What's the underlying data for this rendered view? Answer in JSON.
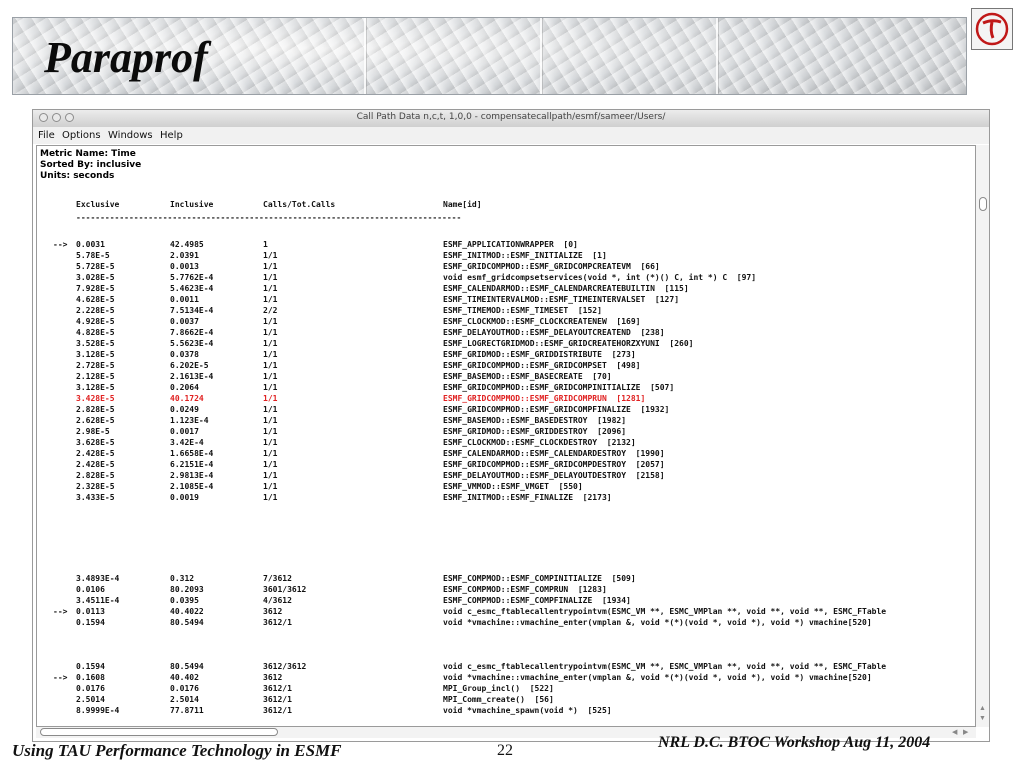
{
  "slide": {
    "title": "Paraprof",
    "footer_left": "Using TAU Performance Technology in ESMF",
    "page_number": "22",
    "footer_right": "NRL D.C. BTOC Workshop Aug 11, 2004",
    "logo_icon": "tau-logo-icon"
  },
  "window": {
    "title": "Call Path Data n,c,t, 1,0,0 - compensatecallpath/esmf/sameer/Users/",
    "menu": [
      "File",
      "Options",
      "Windows",
      "Help"
    ],
    "metric_name": "Metric Name: Time",
    "sorted_by": "Sorted By: inclusive",
    "units": "Units: seconds"
  },
  "table": {
    "headers": {
      "exclusive": "Exclusive",
      "inclusive": "Inclusive",
      "calls": "Calls/Tot.Calls",
      "name": "Name[id]"
    },
    "separator": "--------------------------------------------------------------------------------",
    "blocks": [
      [
        {
          "arrow": "-->",
          "exc": "0.0031",
          "inc": "42.4985",
          "calls": "1",
          "name": "ESMF_APPLICATIONWRAPPER  [0]"
        },
        {
          "arrow": "",
          "exc": "5.78E-5",
          "inc": "2.0391",
          "calls": "1/1",
          "name": "ESMF_INITMOD::ESMF_INITIALIZE  [1]"
        },
        {
          "arrow": "",
          "exc": "5.728E-5",
          "inc": "0.0013",
          "calls": "1/1",
          "name": "ESMF_GRIDCOMPMOD::ESMF_GRIDCOMPCREATEVM  [66]"
        },
        {
          "arrow": "",
          "exc": "3.028E-5",
          "inc": "5.7762E-4",
          "calls": "1/1",
          "name": "void esmf_gridcompsetservices(void *, int (*)() C, int *) C  [97]"
        },
        {
          "arrow": "",
          "exc": "7.928E-5",
          "inc": "5.4623E-4",
          "calls": "1/1",
          "name": "ESMF_CALENDARMOD::ESMF_CALENDARCREATEBUILTIN  [115]"
        },
        {
          "arrow": "",
          "exc": "4.628E-5",
          "inc": "0.0011",
          "calls": "1/1",
          "name": "ESMF_TIMEINTERVALMOD::ESMF_TIMEINTERVALSET  [127]"
        },
        {
          "arrow": "",
          "exc": "2.228E-5",
          "inc": "7.5134E-4",
          "calls": "2/2",
          "name": "ESMF_TIMEMOD::ESMF_TIMESET  [152]"
        },
        {
          "arrow": "",
          "exc": "4.928E-5",
          "inc": "0.0037",
          "calls": "1/1",
          "name": "ESMF_CLOCKMOD::ESMF_CLOCKCREATENEW  [169]"
        },
        {
          "arrow": "",
          "exc": "4.828E-5",
          "inc": "7.8662E-4",
          "calls": "1/1",
          "name": "ESMF_DELAYOUTMOD::ESMF_DELAYOUTCREATEND  [238]"
        },
        {
          "arrow": "",
          "exc": "3.528E-5",
          "inc": "5.5623E-4",
          "calls": "1/1",
          "name": "ESMF_LOGRECTGRIDMOD::ESMF_GRIDCREATEHORZXYUNI  [260]"
        },
        {
          "arrow": "",
          "exc": "3.128E-5",
          "inc": "0.0378",
          "calls": "1/1",
          "name": "ESMF_GRIDMOD::ESMF_GRIDDISTRIBUTE  [273]"
        },
        {
          "arrow": "",
          "exc": "2.728E-5",
          "inc": "6.202E-5",
          "calls": "1/1",
          "name": "ESMF_GRIDCOMPMOD::ESMF_GRIDCOMPSET  [498]"
        },
        {
          "arrow": "",
          "exc": "2.128E-5",
          "inc": "2.1613E-4",
          "calls": "1/1",
          "name": "ESMF_BASEMOD::ESMF_BASECREATE  [70]"
        },
        {
          "arrow": "",
          "exc": "3.128E-5",
          "inc": "0.2064",
          "calls": "1/1",
          "name": "ESMF_GRIDCOMPMOD::ESMF_GRIDCOMPINITIALIZE  [507]"
        },
        {
          "arrow": "",
          "exc": "3.428E-5",
          "inc": "40.1724",
          "calls": "1/1",
          "name": "ESMF_GRIDCOMPMOD::ESMF_GRIDCOMPRUN  [1281]",
          "highlight": true
        },
        {
          "arrow": "",
          "exc": "2.828E-5",
          "inc": "0.0249",
          "calls": "1/1",
          "name": "ESMF_GRIDCOMPMOD::ESMF_GRIDCOMPFINALIZE  [1932]"
        },
        {
          "arrow": "",
          "exc": "2.628E-5",
          "inc": "1.123E-4",
          "calls": "1/1",
          "name": "ESMF_BASEMOD::ESMF_BASEDESTROY  [1982]"
        },
        {
          "arrow": "",
          "exc": "2.98E-5",
          "inc": "0.0017",
          "calls": "1/1",
          "name": "ESMF_GRIDMOD::ESMF_GRIDDESTROY  [2096]"
        },
        {
          "arrow": "",
          "exc": "3.628E-5",
          "inc": "3.42E-4",
          "calls": "1/1",
          "name": "ESMF_CLOCKMOD::ESMF_CLOCKDESTROY  [2132]"
        },
        {
          "arrow": "",
          "exc": "2.428E-5",
          "inc": "1.6658E-4",
          "calls": "1/1",
          "name": "ESMF_CALENDARMOD::ESMF_CALENDARDESTROY  [1990]"
        },
        {
          "arrow": "",
          "exc": "2.428E-5",
          "inc": "6.2151E-4",
          "calls": "1/1",
          "name": "ESMF_GRIDCOMPMOD::ESMF_GRIDCOMPDESTROY  [2057]"
        },
        {
          "arrow": "",
          "exc": "2.828E-5",
          "inc": "2.9813E-4",
          "calls": "1/1",
          "name": "ESMF_DELAYOUTMOD::ESMF_DELAYOUTDESTROY  [2158]"
        },
        {
          "arrow": "",
          "exc": "2.328E-5",
          "inc": "2.1085E-4",
          "calls": "1/1",
          "name": "ESMF_VMMOD::ESMF_VMGET  [550]"
        },
        {
          "arrow": "",
          "exc": "3.433E-5",
          "inc": "0.0019",
          "calls": "1/1",
          "name": "ESMF_INITMOD::ESMF_FINALIZE  [2173]"
        }
      ],
      [
        {
          "arrow": "",
          "exc": "3.4893E-4",
          "inc": "0.312",
          "calls": "7/3612",
          "name": "ESMF_COMPMOD::ESMF_COMPINITIALIZE  [509]"
        },
        {
          "arrow": "",
          "exc": "0.0106",
          "inc": "80.2093",
          "calls": "3601/3612",
          "name": "ESMF_COMPMOD::ESMF_COMPRUN  [1283]"
        },
        {
          "arrow": "",
          "exc": "3.4511E-4",
          "inc": "0.0395",
          "calls": "4/3612",
          "name": "ESMF_COMPMOD::ESMF_COMPFINALIZE  [1934]"
        },
        {
          "arrow": "-->",
          "exc": "0.0113",
          "inc": "40.4022",
          "calls": "3612",
          "name": "void c_esmc_ftablecallentrypointvm(ESMC_VM **, ESMC_VMPlan **, void **, void **, ESMC_FTable"
        },
        {
          "arrow": "",
          "exc": "0.1594",
          "inc": "80.5494",
          "calls": "3612/1",
          "name": "void *vmachine::vmachine_enter(vmplan &, void *(*)(void *, void *), void *) vmachine[520]"
        }
      ],
      [
        {
          "arrow": "",
          "exc": "0.1594",
          "inc": "80.5494",
          "calls": "3612/3612",
          "name": "void c_esmc_ftablecallentrypointvm(ESMC_VM **, ESMC_VMPlan **, void **, void **, ESMC_FTable"
        },
        {
          "arrow": "-->",
          "exc": "0.1608",
          "inc": "40.402",
          "calls": "3612",
          "name": "void *vmachine::vmachine_enter(vmplan &, void *(*)(void *, void *), void *) vmachine[520]"
        },
        {
          "arrow": "",
          "exc": "0.0176",
          "inc": "0.0176",
          "calls": "3612/1",
          "name": "MPI_Group_incl()  [522]"
        },
        {
          "arrow": "",
          "exc": "2.5014",
          "inc": "2.5014",
          "calls": "3612/1",
          "name": "MPI_Comm_create()  [56]"
        },
        {
          "arrow": "",
          "exc": "8.9999E-4",
          "inc": "77.8711",
          "calls": "3612/1",
          "name": "void *vmachine_spawn(void *)  [525]"
        }
      ]
    ]
  },
  "colors": {
    "highlight": "#e02020"
  }
}
